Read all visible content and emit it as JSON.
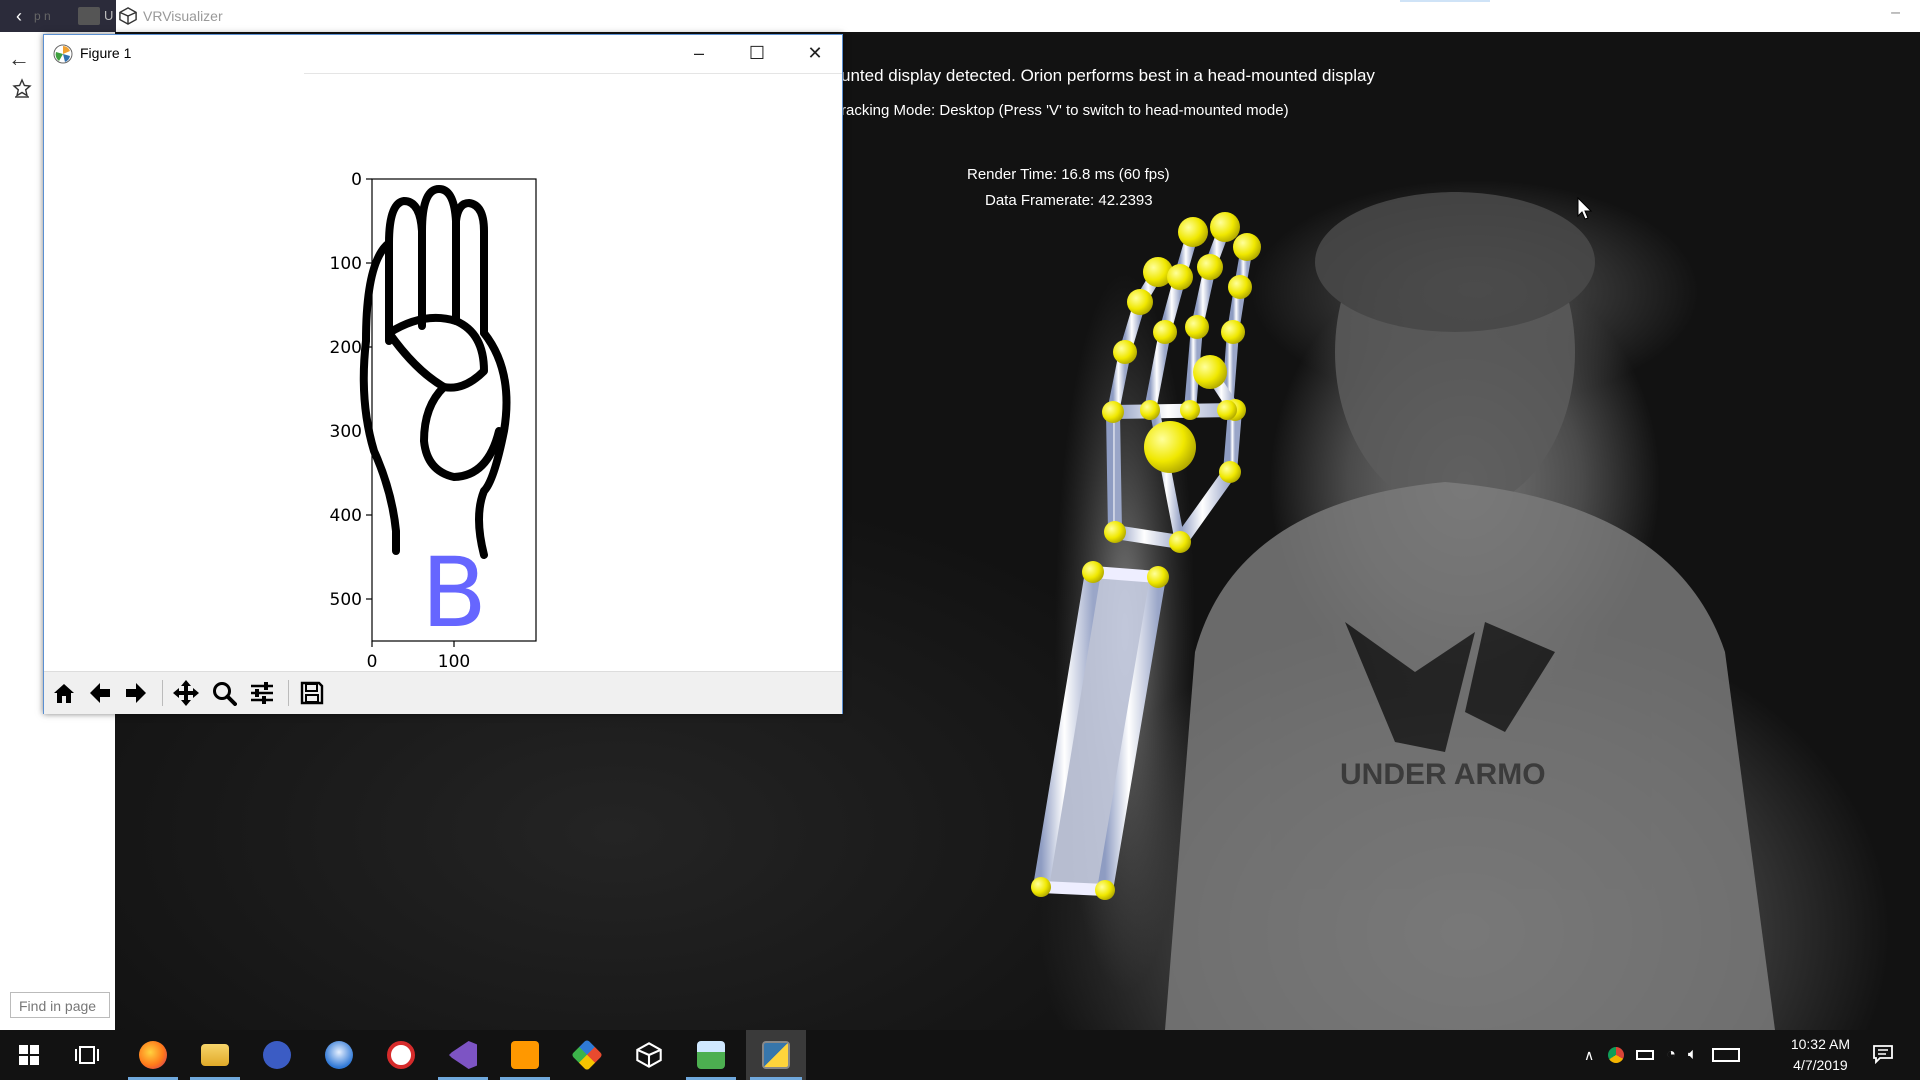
{
  "top": {
    "app_title": "VRVisualizer",
    "tab_u": "U",
    "tab_ghost": "p n"
  },
  "browser": {
    "find_placeholder": "Find in page"
  },
  "scene": {
    "line1": "unted display detected. Orion performs best in a head-mounted display",
    "line2": "racking Mode: Desktop (Press 'V' to switch to head-mounted mode)",
    "render_time": "Render Time: 16.8 ms (60 fps)",
    "data_framerate": "Data Framerate: 42.2393",
    "shirt_text": "UNDER ARMO"
  },
  "figure": {
    "title": "Figure 1",
    "letter": "B",
    "letter_color": "#6666ff",
    "chart_data": {
      "type": "image",
      "title": "",
      "xlabel": "",
      "ylabel": "",
      "x_ticks": [
        "0",
        "100"
      ],
      "y_ticks": [
        "0",
        "100",
        "200",
        "300",
        "400",
        "500"
      ],
      "xlim": [
        0,
        200
      ],
      "ylim": [
        550,
        0
      ]
    },
    "toolbar": [
      "home-icon",
      "back-icon",
      "forward-icon",
      "pan-icon",
      "zoom-icon",
      "configure-icon",
      "save-icon"
    ]
  },
  "taskbar": {
    "time": "10:32 AM",
    "date": "4/7/2019",
    "accent": "#6fa8dc"
  }
}
